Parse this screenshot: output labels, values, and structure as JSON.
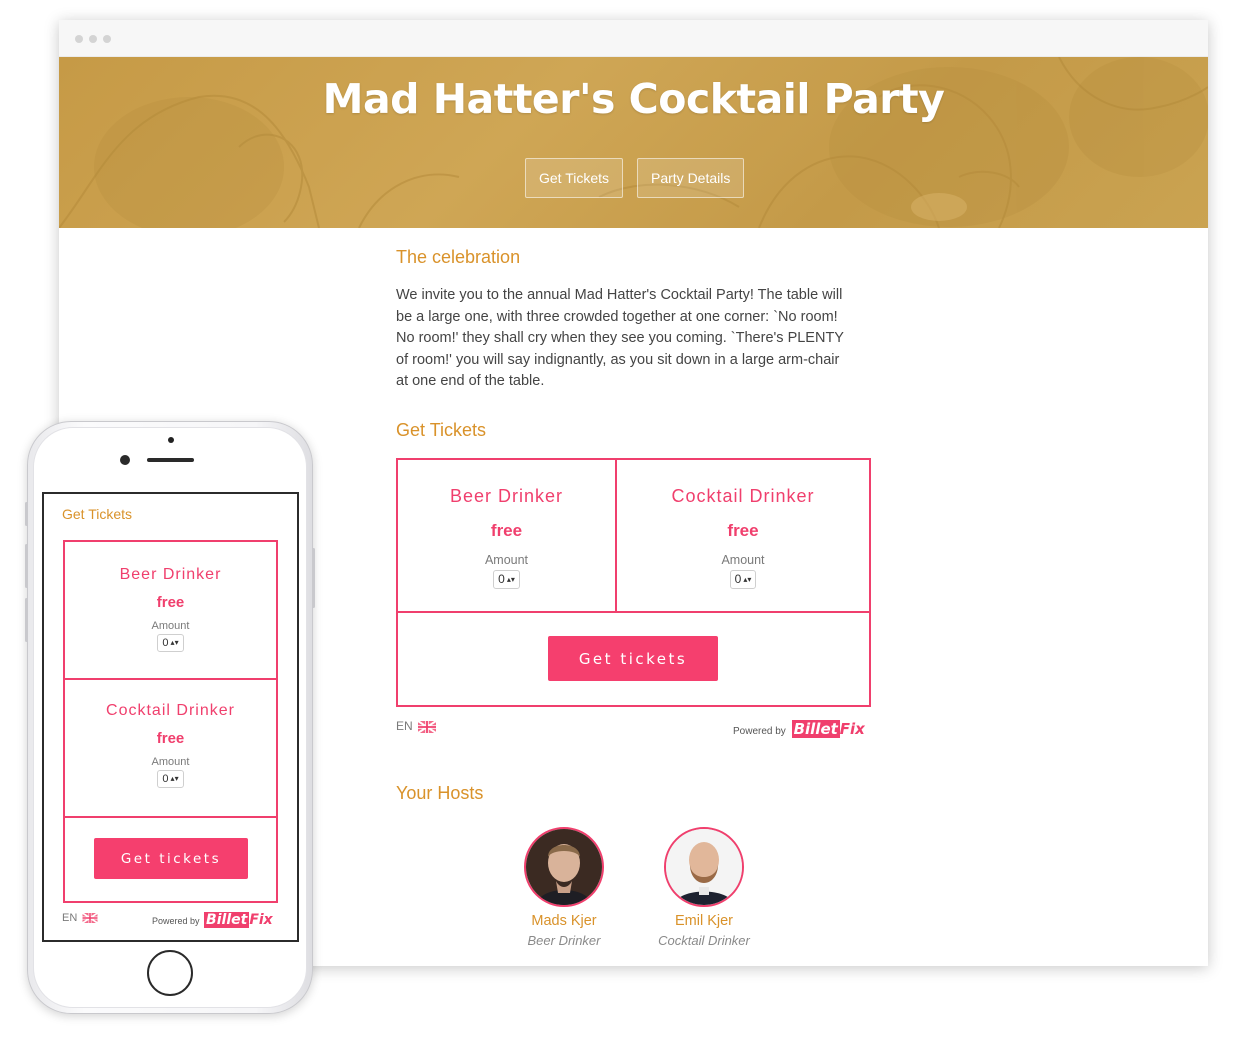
{
  "desktop": {
    "hero": {
      "title": "Mad Hatter's Cocktail Party",
      "buttons": [
        "Get Tickets",
        "Party Details"
      ]
    },
    "celebration": {
      "heading": "The celebration",
      "lines": [
        "We invite you to the annual Mad Hatter's Cocktail Party! The table will",
        "be a large one, with three crowded together at one corner: `No room!",
        "No room!' they shall cry when they see you coming. `There's PLENTY",
        "of room!' you will say indignantly, as you sit down in a large arm-chair",
        "at one end of the table."
      ]
    },
    "tickets": {
      "heading": "Get Tickets",
      "items": [
        {
          "name": "Beer Drinker",
          "price": "free",
          "amount_label": "Amount",
          "amount": "0"
        },
        {
          "name": "Cocktail Drinker",
          "price": "free",
          "amount_label": "Amount",
          "amount": "0"
        }
      ],
      "button": "Get tickets",
      "language": "EN",
      "powered_by": "Powered by",
      "brand_a": "Billet",
      "brand_b": "Fix"
    },
    "hosts": {
      "heading": "Your Hosts",
      "people": [
        {
          "name": "Mads Kjer",
          "role": "Beer Drinker"
        },
        {
          "name": "Emil Kjer",
          "role": "Cocktail Drinker"
        }
      ]
    }
  },
  "mobile": {
    "heading": "Get Tickets",
    "items": [
      {
        "name": "Beer Drinker",
        "price": "free",
        "amount_label": "Amount",
        "amount": "0"
      },
      {
        "name": "Cocktail Drinker",
        "price": "free",
        "amount_label": "Amount",
        "amount": "0"
      }
    ],
    "button": "Get tickets",
    "language": "EN",
    "powered_by": "Powered by",
    "brand_a": "Billet",
    "brand_b": "Fix"
  },
  "colors": {
    "accent_pink": "#f03f6d",
    "accent_gold": "#d9922a",
    "hero_gold": "#c9a04d"
  }
}
